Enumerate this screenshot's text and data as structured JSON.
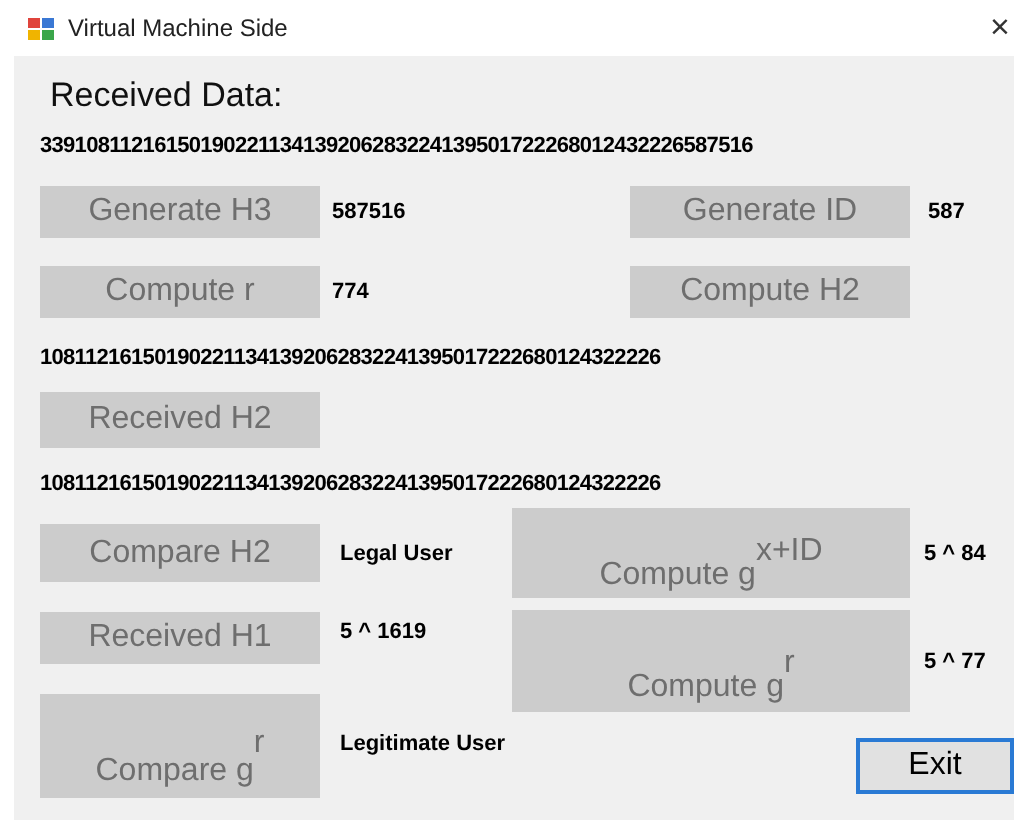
{
  "window": {
    "title": "Virtual Machine Side",
    "close": "×"
  },
  "heading": "Received Data:",
  "received_data": "339108112161501902211341392062832241395017222680124322265875​16",
  "top_rows": [
    {
      "left": {
        "label": "Generate H3",
        "disabled": true
      },
      "left_value": "587516",
      "right": {
        "label": "Generate ID",
        "disabled": true
      },
      "right_value": "587"
    },
    {
      "left": {
        "label": "Compute r",
        "disabled": true
      },
      "left_value": "774",
      "right": {
        "label": "Compute H2",
        "disabled": true
      }
    }
  ],
  "h2_computed": "108112161501902211341392062832241395017222680124322226",
  "received_h2_button": {
    "label": "Received H2",
    "disabled": true
  },
  "h2_received": "108112161501902211341392062832241395017222680124322226",
  "left_actions": [
    {
      "label": "Compare H2",
      "disabled": true,
      "result": "Legal User"
    },
    {
      "label": "Received H1",
      "disabled": true,
      "result": "5 ^ 1619"
    },
    {
      "label": "Compare g$^{r}$",
      "disabled": true,
      "result": "Legitimate User"
    }
  ],
  "right_actions": [
    {
      "label": "Compute g$^{x+ID}$",
      "disabled": true,
      "result": "5 ^ 84"
    },
    {
      "label": "Compute g$^{r}$",
      "disabled": true,
      "result": "5 ^ 77"
    }
  ],
  "exit_button": {
    "label": "Exit",
    "disabled": false
  }
}
